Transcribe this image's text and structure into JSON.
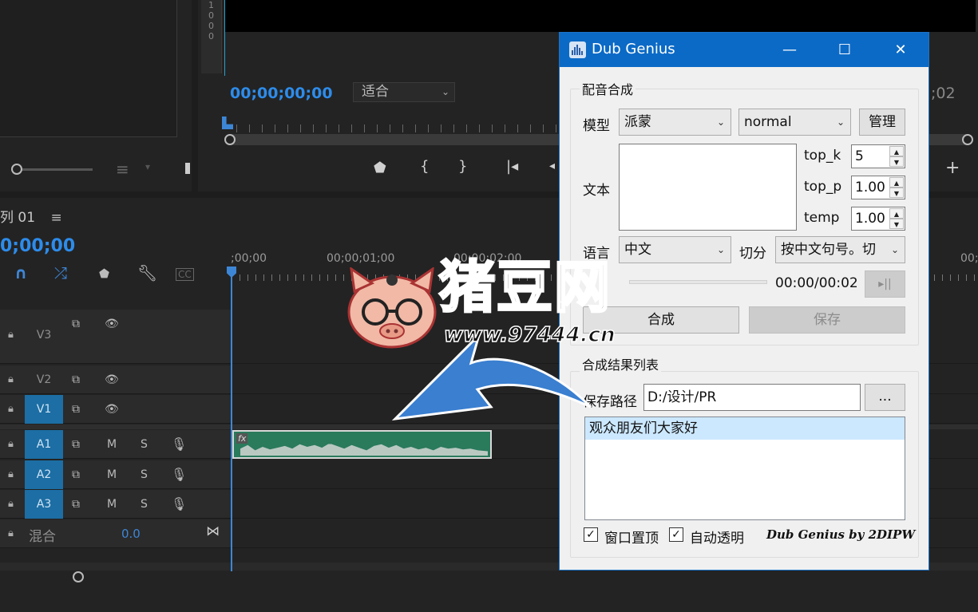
{
  "premiere": {
    "ruler_digits": [
      "1",
      "0",
      "0",
      "0"
    ],
    "program_timecode": "00;00;00;00",
    "fit_select": "适合",
    "program_end_tc": ";02",
    "sequence_tab": "列 01",
    "sequence_timecode": "0;00;00",
    "ruler_labels": [
      ";00;00",
      "00;00;01;00",
      "00;00;02;00",
      "00;"
    ],
    "tracks": [
      {
        "name": "V3",
        "active": false,
        "type": "video"
      },
      {
        "name": "V2",
        "active": false,
        "type": "video"
      },
      {
        "name": "V1",
        "active": true,
        "type": "video"
      },
      {
        "name": "A1",
        "active": true,
        "type": "audio"
      },
      {
        "name": "A2",
        "active": true,
        "type": "audio"
      },
      {
        "name": "A3",
        "active": true,
        "type": "audio"
      }
    ],
    "audio_m": "M",
    "audio_s": "S",
    "mix_label": "混合",
    "mix_value": "0.0",
    "clip_fx": "fx"
  },
  "dub": {
    "title": "Dub Genius",
    "controls": {
      "minimize": "—",
      "maximize": "☐",
      "close": "✕"
    },
    "synth_group": "配音合成",
    "model_label": "模型",
    "model_value": "派蒙",
    "mode_value": "normal",
    "manage_button": "管理",
    "text_label": "文本",
    "text_value": "",
    "top_k_label": "top_k",
    "top_k_value": "5",
    "top_p_label": "top_p",
    "top_p_value": "1.00",
    "temp_label": "temp",
    "temp_value": "1.00",
    "lang_label": "语言",
    "lang_value": "中文",
    "split_label": "切分",
    "split_value": "按中文句号。切",
    "time_display": "00:00/00:02",
    "play_button": "▸||",
    "synth_button": "合成",
    "save_button": "保存",
    "results_group": "合成结果列表",
    "save_path_label": "保存路径",
    "save_path_value": "D:/设计/PR",
    "browse_button": "...",
    "results": [
      "观众朋友们大家好"
    ],
    "topmost_label": "窗口置顶",
    "auto_transparent_label": "自动透明",
    "credit": "Dub Genius by 2DIPW"
  },
  "watermark": {
    "title": "猪豆网",
    "url": "www.97444.cn"
  }
}
